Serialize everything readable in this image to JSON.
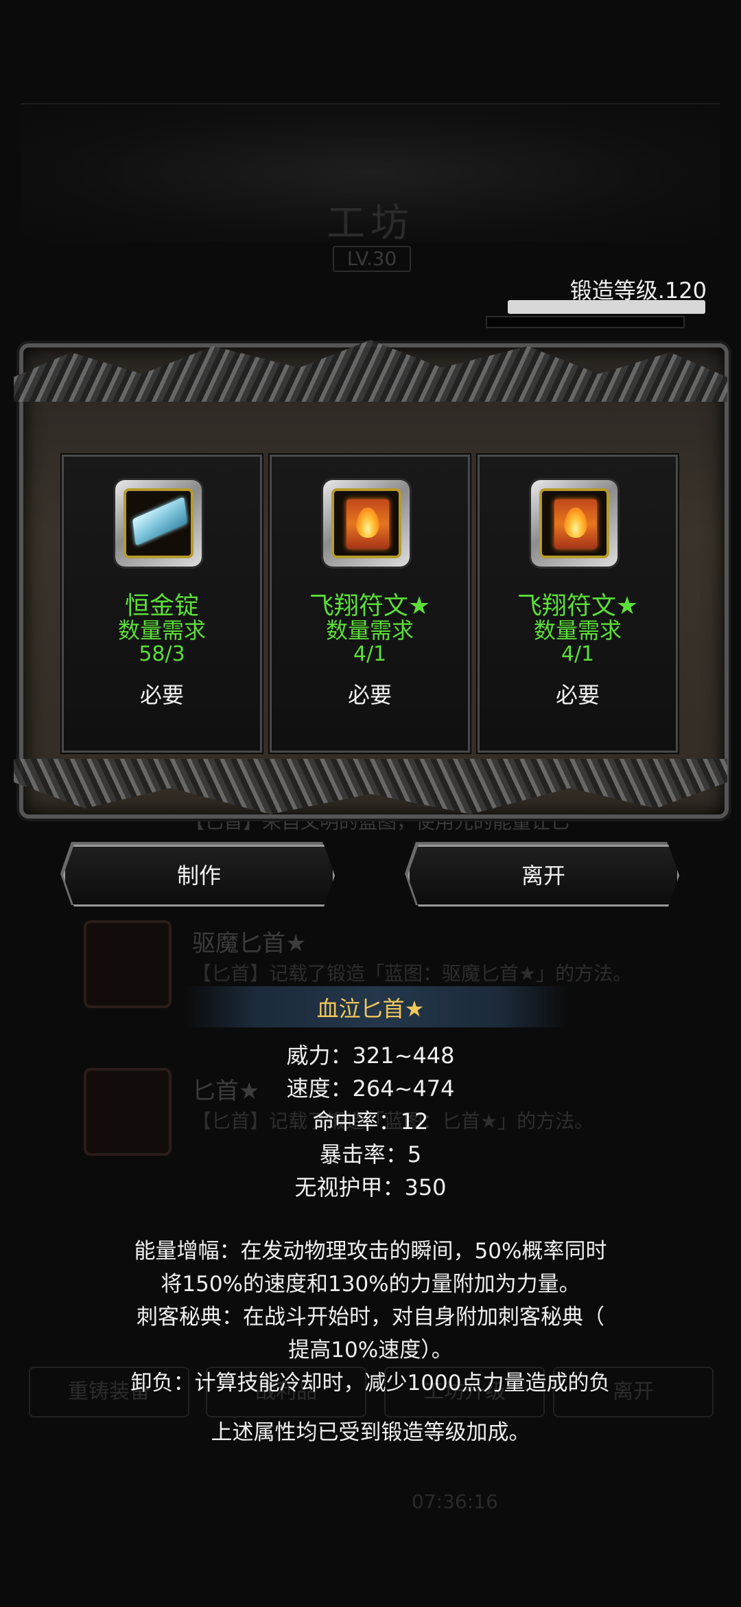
{
  "background": {
    "title": "工坊",
    "level": "LV.30",
    "rows": [
      {
        "title": "驱魔匕首★",
        "desc": "【匕首】记载了锻造「蓝图：驱魔匕首★」的方法。"
      },
      {
        "title": "匕首★",
        "desc": "【匕首】记载了锻造「蓝图：匕首★」的方法。"
      }
    ],
    "under_row_desc": "【匕首】来自文明的蓝图，使用光的能量让匕",
    "bottom_buttons": [
      "重铸装备",
      "战利品",
      "工坊升级",
      "离开"
    ],
    "time": "07:36:16"
  },
  "forge": {
    "label": "锻造等级.120",
    "progress": 1.0
  },
  "materials": [
    {
      "icon": "ingot-icon",
      "name": "恒金锭",
      "requirement_label": "数量需求",
      "count": "58/3",
      "necessity": "必要"
    },
    {
      "icon": "rune-icon",
      "name": "飞翔符文★",
      "requirement_label": "数量需求",
      "count": "4/1",
      "necessity": "必要"
    },
    {
      "icon": "rune-icon",
      "name": "飞翔符文★",
      "requirement_label": "数量需求",
      "count": "4/1",
      "necessity": "必要"
    }
  ],
  "actions": {
    "craft_label": "制作",
    "leave_label": "离开"
  },
  "tooltip": {
    "title": "血泣匕首★",
    "stats": [
      "威力：321~448",
      "速度：264~474",
      "命中率：12",
      "暴击率：5",
      "无视护甲：350"
    ],
    "description": [
      "能量增幅：在发动物理攻击的瞬间，50%概率同时",
      "将150%的速度和130%的力量附加为力量。",
      "刺客秘典：在战斗开始时，对自身附加刺客秘典（",
      "提高10%速度）。",
      "卸负：计算技能冷却时，减少1000点力量造成的负",
      "上述属性均已受到锻造等级加成。"
    ]
  },
  "colors": {
    "material_text": "#5cde3a",
    "tooltip_title": "#f3c85a",
    "background": "#0b0b0b"
  }
}
